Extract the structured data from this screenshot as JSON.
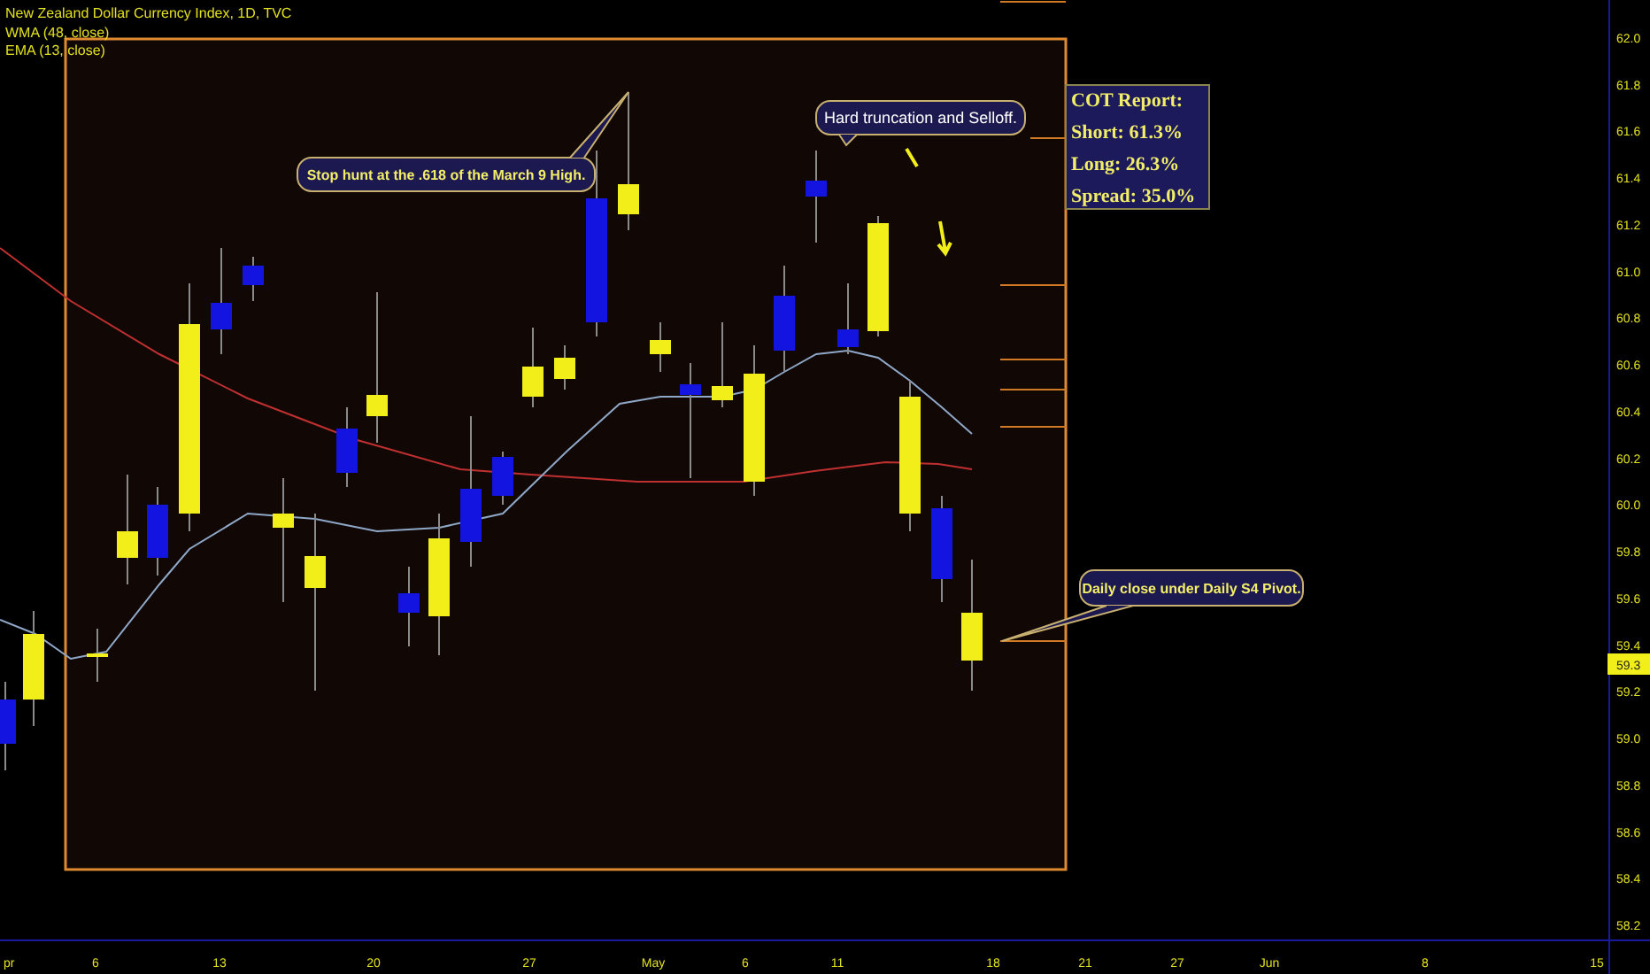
{
  "legend": {
    "title": "New Zealand Dollar Currency Index, 1D, TVC",
    "indicators": [
      "WMA (48, close)",
      "EMA (13, close)"
    ]
  },
  "callouts": [
    {
      "kind": "bold",
      "text": "Stop hunt at the .618 of the March 9 High."
    },
    {
      "kind": "plain",
      "text": "Hard truncation and Selloff."
    },
    {
      "kind": "bold",
      "text": "Daily close under Daily S4 Pivot."
    }
  ],
  "cot_report": [
    "COT Report:",
    "Short: 61.3%",
    "Long: 26.3%",
    "Spread: 35.0%"
  ],
  "price_axis": [
    "62.0",
    "61.8",
    "61.6",
    "61.4",
    "61.2",
    "61.0",
    "60.8",
    "60.6",
    "60.4",
    "60.2",
    "60.0",
    "59.8",
    "59.6",
    "59.4",
    "59.2",
    "59.0",
    "58.8",
    "58.6",
    "58.4",
    "58.2"
  ],
  "current_price": "59.3",
  "time_axis": [
    "pr",
    "6",
    "13",
    "20",
    "27",
    "May",
    "6",
    "11",
    "18",
    "21",
    "27",
    "Jun",
    "8",
    "15"
  ]
}
